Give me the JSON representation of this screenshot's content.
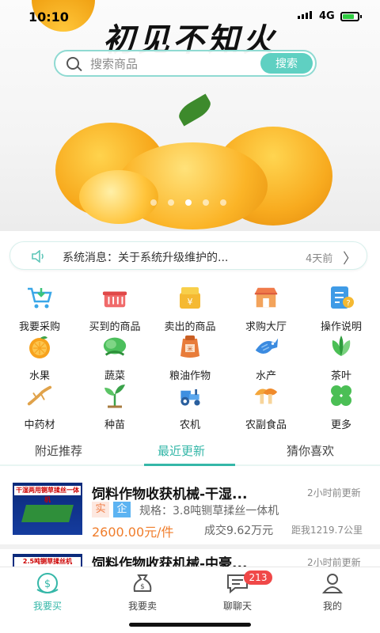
{
  "status": {
    "time": "10:10",
    "network": "4G",
    "battery_level": 0.8
  },
  "hero": {
    "title": "初见不知火"
  },
  "search": {
    "placeholder": "搜索商品",
    "button": "搜索"
  },
  "notice": {
    "text": "系统消息：关于系统升级维护的...",
    "time": "4天前"
  },
  "grid": [
    {
      "label": "我要采购",
      "icon": "cart-icon"
    },
    {
      "label": "买到的商品",
      "icon": "basket-icon"
    },
    {
      "label": "卖出的商品",
      "icon": "money-box-icon"
    },
    {
      "label": "求购大厅",
      "icon": "shop-icon"
    },
    {
      "label": "操作说明",
      "icon": "help-doc-icon"
    },
    {
      "label": "水果",
      "icon": "orange-icon"
    },
    {
      "label": "蔬菜",
      "icon": "vegetable-icon"
    },
    {
      "label": "粮油作物",
      "icon": "rice-sack-icon"
    },
    {
      "label": "水产",
      "icon": "fish-icon"
    },
    {
      "label": "茶叶",
      "icon": "tea-leaf-icon"
    },
    {
      "label": "中药材",
      "icon": "ginseng-icon"
    },
    {
      "label": "种苗",
      "icon": "seedling-icon"
    },
    {
      "label": "农机",
      "icon": "tractor-icon"
    },
    {
      "label": "农副食品",
      "icon": "mushroom-icon"
    },
    {
      "label": "更多",
      "icon": "more-clover-icon"
    }
  ],
  "tabs": [
    {
      "label": "附近推荐"
    },
    {
      "label": "最近更新"
    },
    {
      "label": "猜你喜欢"
    }
  ],
  "products": [
    {
      "title": "饲料作物收获机械-干湿...",
      "time": "2小时前更新",
      "tag1": "实",
      "tag2": "企",
      "spec": "规格：3.8吨铡草揉丝一体机",
      "price": "2600.00元/件",
      "deal": "成交9.62万元",
      "distance": "距我1219.7公里",
      "thumb_text": "干湿两用铡草揉丝一体机"
    },
    {
      "title": "饲料作物收获机械-中豪...",
      "time": "2小时前更新",
      "thumb_text": "2.5吨铡草揉丝机"
    }
  ],
  "bottomnav": [
    {
      "label": "我要买",
      "icon": "buy-icon"
    },
    {
      "label": "我要卖",
      "icon": "sell-bag-icon"
    },
    {
      "label": "聊聊天",
      "icon": "chat-icon",
      "badge": "213"
    },
    {
      "label": "我的",
      "icon": "profile-icon"
    }
  ],
  "colors": {
    "accent": "#35b7a8",
    "price": "#f07d2b",
    "badge": "#f04848"
  }
}
